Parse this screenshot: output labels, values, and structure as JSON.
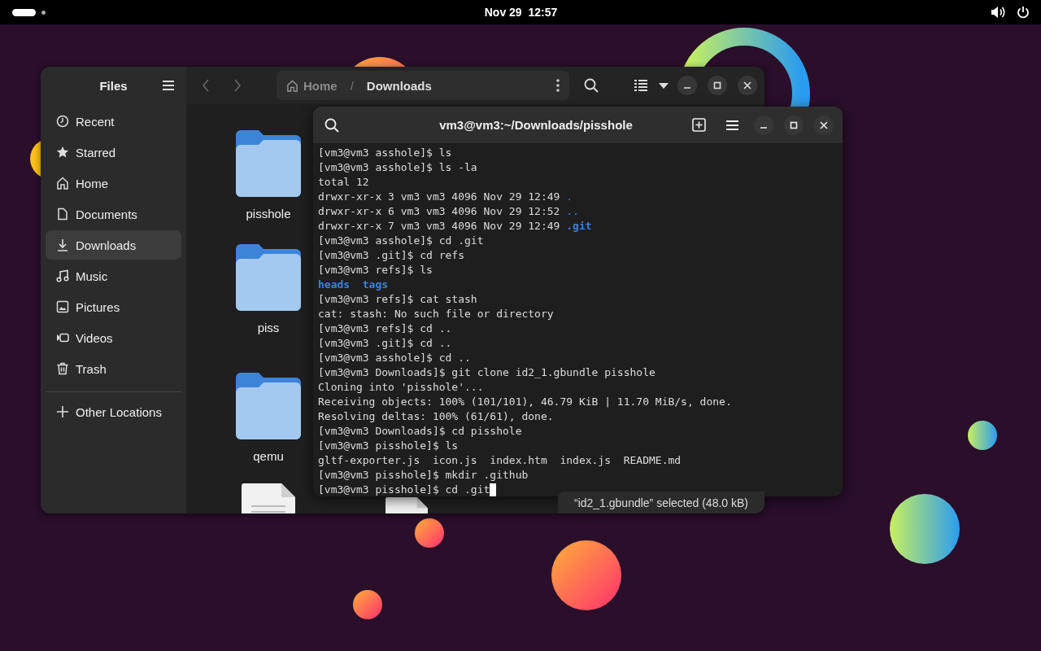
{
  "top_bar": {
    "clock": "Nov 29  12:57"
  },
  "files": {
    "sidebar_title": "Files",
    "sidebar": [
      {
        "label": "Recent",
        "selected": false
      },
      {
        "label": "Starred",
        "selected": false
      },
      {
        "label": "Home",
        "selected": false
      },
      {
        "label": "Documents",
        "selected": false
      },
      {
        "label": "Downloads",
        "selected": true
      },
      {
        "label": "Music",
        "selected": false
      },
      {
        "label": "Pictures",
        "selected": false
      },
      {
        "label": "Videos",
        "selected": false
      },
      {
        "label": "Trash",
        "selected": false
      }
    ],
    "other_locations": "Other Locations",
    "path": [
      "Home",
      "Downloads"
    ],
    "path_separator": "/",
    "item_rows": [
      [
        {
          "kind": "folder",
          "label": "pisshole"
        }
      ],
      [
        {
          "kind": "folder",
          "label": "piss"
        }
      ],
      [
        {
          "kind": "folder",
          "label": "qemu"
        }
      ],
      [
        {
          "kind": "document"
        },
        {
          "kind": "document"
        }
      ]
    ],
    "status": "“id2_1.gbundle” selected (48.0 kB)"
  },
  "terminal": {
    "title": "vm3@vm3:~/Downloads/pisshole",
    "cursor": true,
    "lines": [
      [
        {
          "kind": "plain",
          "text": "[vm3@vm3 asshole]$ ls"
        }
      ],
      [
        {
          "kind": "plain",
          "text": "[vm3@vm3 asshole]$ ls -la"
        }
      ],
      [
        {
          "kind": "plain",
          "text": "total 12"
        }
      ],
      [
        {
          "kind": "plain",
          "text": "drwxr-xr-x 3 vm3 vm3 4096 Nov 29 12:49 "
        },
        {
          "kind": "dir",
          "text": "."
        }
      ],
      [
        {
          "kind": "plain",
          "text": "drwxr-xr-x 6 vm3 vm3 4096 Nov 29 12:52 "
        },
        {
          "kind": "dir",
          "text": ".."
        }
      ],
      [
        {
          "kind": "plain",
          "text": "drwxr-xr-x 7 vm3 vm3 4096 Nov 29 12:49 "
        },
        {
          "kind": "dir_bold",
          "text": ".git"
        }
      ],
      [
        {
          "kind": "plain",
          "text": "[vm3@vm3 asshole]$ cd .git"
        }
      ],
      [
        {
          "kind": "plain",
          "text": "[vm3@vm3 .git]$ cd refs"
        }
      ],
      [
        {
          "kind": "plain",
          "text": "[vm3@vm3 refs]$ ls"
        }
      ],
      [
        {
          "kind": "dir_bold",
          "text": "heads  tags"
        }
      ],
      [
        {
          "kind": "plain",
          "text": "[vm3@vm3 refs]$ cat stash"
        }
      ],
      [
        {
          "kind": "plain",
          "text": "cat: stash: No such file or directory"
        }
      ],
      [
        {
          "kind": "plain",
          "text": "[vm3@vm3 refs]$ cd .."
        }
      ],
      [
        {
          "kind": "plain",
          "text": "[vm3@vm3 .git]$ cd .."
        }
      ],
      [
        {
          "kind": "plain",
          "text": "[vm3@vm3 asshole]$ cd .."
        }
      ],
      [
        {
          "kind": "plain",
          "text": "[vm3@vm3 Downloads]$ git clone id2_1.gbundle pisshole"
        }
      ],
      [
        {
          "kind": "plain",
          "text": "Cloning into 'pisshole'..."
        }
      ],
      [
        {
          "kind": "plain",
          "text": "Receiving objects: 100% (101/101), 46.79 KiB | 11.70 MiB/s, done."
        }
      ],
      [
        {
          "kind": "plain",
          "text": "Resolving deltas: 100% (61/61), done."
        }
      ],
      [
        {
          "kind": "plain",
          "text": "[vm3@vm3 Downloads]$ cd pisshole"
        }
      ],
      [
        {
          "kind": "plain",
          "text": "[vm3@vm3 pisshole]$ ls"
        }
      ],
      [
        {
          "kind": "plain",
          "text": "gltf-exporter.js  icon.js  index.htm  index.js  README.md"
        }
      ],
      [
        {
          "kind": "plain",
          "text": "[vm3@vm3 pisshole]$ mkdir .github"
        }
      ],
      [
        {
          "kind": "plain",
          "text": "[vm3@vm3 pisshole]$ cd .git"
        }
      ]
    ]
  }
}
